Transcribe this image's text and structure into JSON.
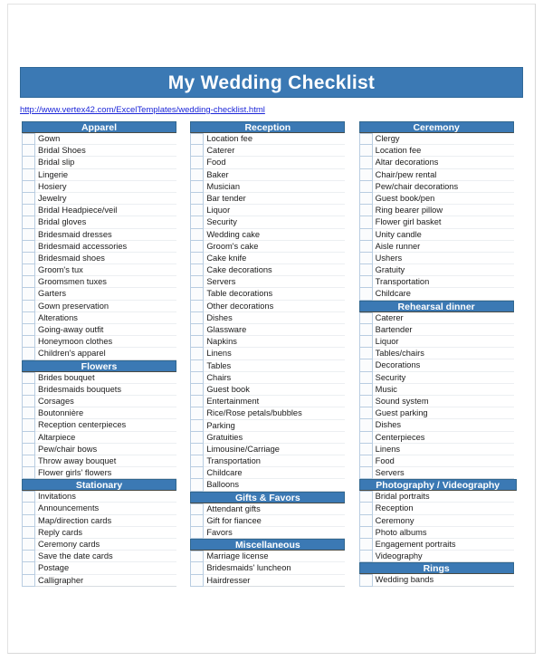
{
  "document": {
    "title": "My Wedding Checklist",
    "source_url": "http://www.vertex42.com/ExcelTemplates/wedding-checklist.html",
    "accent_color": "#3B79B4",
    "link_color": "#1c26d8",
    "checkbox_border_color": "#b9cde1"
  },
  "columns": [
    {
      "name": "column-1",
      "sections": [
        {
          "heading": "Apparel",
          "items": [
            "Gown",
            "Bridal Shoes",
            "Bridal slip",
            "Lingerie",
            "Hosiery",
            "Jewelry",
            "Bridal Headpiece/veil",
            "Bridal gloves",
            "Bridesmaid dresses",
            "Bridesmaid accessories",
            "Bridesmaid shoes",
            "Groom's tux",
            "Groomsmen tuxes",
            "Garters",
            "Gown preservation",
            "Alterations",
            "Going-away outfit",
            "Honeymoon clothes",
            "Children's apparel"
          ]
        },
        {
          "heading": "Flowers",
          "items": [
            "Brides bouquet",
            "Bridesmaids bouquets",
            "Corsages",
            "Boutonnière",
            "Reception centerpieces",
            "Altarpiece",
            "Pew/chair bows",
            "Throw away bouquet",
            "Flower girls' flowers"
          ]
        },
        {
          "heading": "Stationary",
          "items": [
            "Invitations",
            "Announcements",
            "Map/direction cards",
            "Reply cards",
            "Ceremony cards",
            "Save the date cards",
            "Postage",
            "Calligrapher"
          ]
        }
      ]
    },
    {
      "name": "column-2",
      "sections": [
        {
          "heading": "Reception",
          "items": [
            "Location fee",
            "Caterer",
            "Food",
            "Baker",
            "Musician",
            "Bar tender",
            "Liquor",
            "Security",
            "Wedding cake",
            "Groom's cake",
            "Cake knife",
            "Cake decorations",
            "Servers",
            "Table decorations",
            "Other decorations",
            "Dishes",
            "Glassware",
            "Napkins",
            "Linens",
            "Tables",
            "Chairs",
            "Guest book",
            "Entertainment",
            "Rice/Rose petals/bubbles",
            "Parking",
            "Gratuities",
            "Limousine/Carriage",
            "Transportation",
            "Childcare",
            "Balloons"
          ]
        },
        {
          "heading": "Gifts & Favors",
          "items": [
            "Attendant gifts",
            "Gift for fiancee",
            "Favors"
          ]
        },
        {
          "heading": "Miscellaneous",
          "items": [
            "Marriage license",
            "Bridesmaids' luncheon",
            "Hairdresser"
          ]
        }
      ]
    },
    {
      "name": "column-3",
      "sections": [
        {
          "heading": "Ceremony",
          "items": [
            "Clergy",
            "Location fee",
            "Altar decorations",
            "Chair/pew rental",
            "Pew/chair decorations",
            "Guest book/pen",
            "Ring bearer pillow",
            "Flower girl basket",
            "Unity candle",
            "Aisle runner",
            "Ushers",
            "Gratuity",
            "Transportation",
            "Childcare"
          ]
        },
        {
          "heading": "Rehearsal dinner",
          "items": [
            "Caterer",
            "Bartender",
            "Liquor",
            "Tables/chairs",
            "Decorations",
            "Security",
            "Music",
            "Sound system",
            "Guest parking",
            "Dishes",
            "Centerpieces",
            "Linens",
            "Food",
            "Servers"
          ]
        },
        {
          "heading": "Photography / Videography",
          "items": [
            "Bridal portraits",
            "Reception",
            "Ceremony",
            "Photo albums",
            "Engagement portraits",
            "Videography"
          ]
        },
        {
          "heading": "Rings",
          "items": [
            "Wedding bands"
          ]
        }
      ]
    }
  ]
}
